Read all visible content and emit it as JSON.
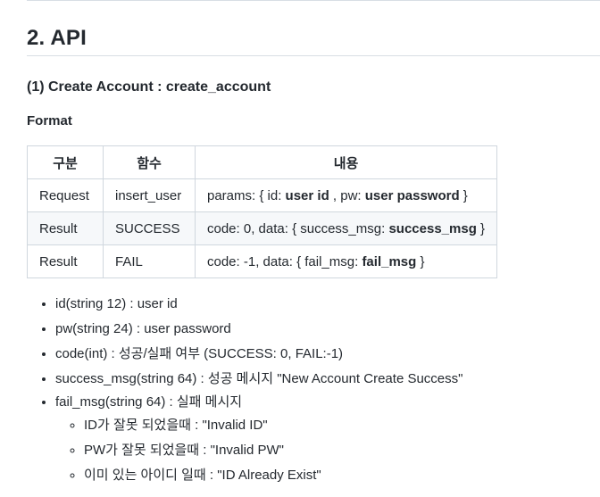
{
  "section_title": "2. API",
  "subsection_title": "(1) Create Account : create_account",
  "format_label": "Format",
  "table": {
    "headers": [
      "구분",
      "함수",
      "내용"
    ],
    "rows": [
      {
        "type": "Request",
        "func": "insert_user",
        "parts": [
          "params: { id: ",
          "user id",
          " , pw: ",
          "user password",
          " }"
        ]
      },
      {
        "type": "Result",
        "func": "SUCCESS",
        "parts": [
          "code: 0, data: { success_msg: ",
          "success_msg",
          " }"
        ]
      },
      {
        "type": "Result",
        "func": "FAIL",
        "parts": [
          "code: -1, data: { fail_msg: ",
          "fail_msg",
          " }"
        ]
      }
    ]
  },
  "fields": [
    "id(string 12) : user id",
    "pw(string 24) : user password",
    "code(int) : 성공/실패 여부 (SUCCESS: 0, FAIL:-1)",
    "success_msg(string 64) : 성공 메시지 \"New Account Create Success\"",
    "fail_msg(string 64) : 실패 메시지"
  ],
  "fail_messages": [
    "ID가 잘못 되었을때 : \"Invalid ID\"",
    "PW가 잘못 되었을때 : \"Invalid PW\"",
    "이미 있는 아이디 일때 : \"ID Already Exist\""
  ]
}
